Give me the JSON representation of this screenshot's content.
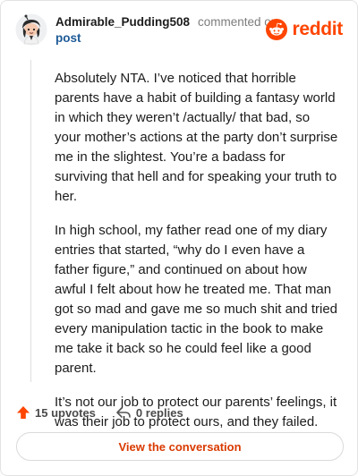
{
  "comment": {
    "username": "Admirable_Pudding508",
    "commented_on": "commented on",
    "post_link": "post",
    "brand": "reddit",
    "paragraphs": [
      "Absolutely NTA. I’ve noticed that horrible parents have a habit of building a fantasy world in which they weren’t /actually/ that bad, so your mother’s actions at the party don’t surprise me in the slightest. You’re a badass for surviving that hell and for speaking your truth to her.",
      "In high school, my father read one of my diary entries that started, “why do I even have a father figure,” and continued on about how awful I felt about how he treated me. That man got so mad and gave me so much shit and tried every manipulation tactic in the book to make me take it back so he could feel like a good parent.",
      "It’s not our job to protect our parents’ feelings, it was their job to protect ours, and they failed."
    ]
  },
  "actions": {
    "upvotes": "15 upvotes",
    "replies": "0 replies"
  },
  "footer": {
    "view_label": "View the conversation"
  },
  "colors": {
    "brand": "#ff4500",
    "link": "#1e5a96",
    "cta": "#d93a00"
  },
  "icons": [
    "avatar",
    "reddit-logo-icon",
    "upvote-icon",
    "reply-icon"
  ]
}
